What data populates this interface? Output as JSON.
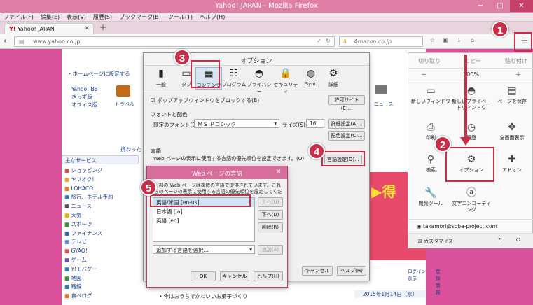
{
  "window": {
    "title": "Yahoo! JAPAN - Mozilla Firefox"
  },
  "menubar": [
    "ファイル(F)",
    "編集(E)",
    "表示(V)",
    "履歴(S)",
    "ブックマーク(B)",
    "ツール(T)",
    "ヘルプ(H)"
  ],
  "tab": {
    "label": "Yahoo! JAPAN"
  },
  "nav": {
    "url": "www.yahoo.co.jp",
    "search_placeholder": "Amazon.co.jp"
  },
  "page": {
    "home_link": "・ホームページに設定する",
    "links": [
      "Yahoo! BB",
      "きっず版",
      "オフィス版"
    ],
    "travel": "トラベル",
    "news": "ニュース",
    "side_title": "主なサービス",
    "services": [
      "ショッピング",
      "ヤフオク!",
      "LOHACO",
      "旅行、ホテル予約",
      "ニュース",
      "天気",
      "スポーツ",
      "ファイナンス",
      "テレビ",
      "GYAO!",
      "ゲーム",
      "Y!モバゲー",
      "地図",
      "路線",
      "食べログ"
    ],
    "tagline": "携わった",
    "login": "ログイン表示",
    "regist": "登録情報",
    "date": "2015年1月14日（水）",
    "footer_line": "・今はおうちでかわいいお菓子づくり"
  },
  "tools": {
    "cut": "切り取り",
    "copy": "コピー",
    "paste": "貼り付け",
    "zoom": "100%",
    "tiles": [
      "新しいウィンドウ",
      "新しいプライベートウィンドウ",
      "ページを保存",
      "印刷",
      "履歴",
      "全画面表示",
      "検索",
      "オプション",
      "アドオン",
      "開発ツール",
      "文字エンコーディング"
    ],
    "account": "takamori@soba-project.com",
    "customize": "カスタマイズ"
  },
  "options": {
    "title": "オプション",
    "panes": [
      "一般",
      "タブ",
      "コンテンツ",
      "プログラム",
      "プライバシー",
      "セキュリティ",
      "Sync",
      "詳細"
    ],
    "popup": "ポップアップウィンドウをブロックする(B)",
    "permit": "許可サイト(E)...",
    "fonts_heading": "フォントと配色",
    "font_label": "既定のフォント(D):",
    "font_value": "ＭＳ Ｐゴシック",
    "size_label": "サイズ(S):",
    "size_value": "16",
    "detail": "詳細設定(A)...",
    "colors": "配色設定(C)...",
    "lang_heading": "言語",
    "lang_desc": "Web ページの表示に使用する言語の優先順位を設定できます。(O)",
    "lang_btn": "言語設定(O)...",
    "cancel": "キャンセル",
    "help": "ヘルプ(H)"
  },
  "lang": {
    "title": "Web ページの言語",
    "desc": "一部の Web ページは複数の言語で提供されています。これらのページの表示に使用する言語の優先順位を設定してください。",
    "items": [
      "英語/米国 [en-us]",
      "日本語 [ja]",
      "英語 [en]"
    ],
    "up": "上へ(U)",
    "down": "下へ(D)",
    "remove": "削除(R)",
    "add_select": "追加する言語を選択...",
    "add": "追加(A)",
    "ok": "OK",
    "cancel": "キャンセル",
    "help": "ヘルプ(H)"
  },
  "badges": [
    "1",
    "2",
    "3",
    "4",
    "5"
  ],
  "colors": {
    "accent": "#c62f49",
    "titlebar": "#e07fa5"
  }
}
